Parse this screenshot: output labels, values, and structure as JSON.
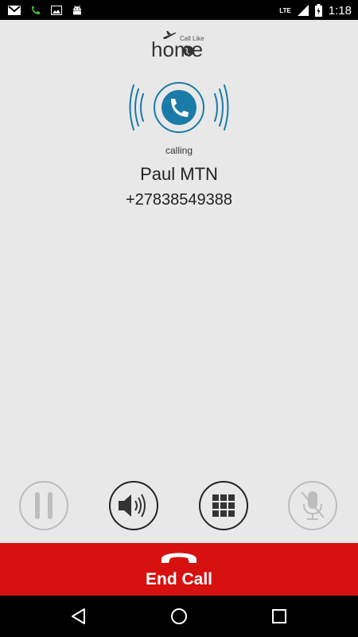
{
  "status_bar": {
    "time": "1:18",
    "network": "LTE",
    "left_icons": [
      "gmail-icon",
      "phone-call-icon",
      "image-icon",
      "android-icon"
    ]
  },
  "logo": {
    "brand": "home",
    "tagline": "Call Like"
  },
  "call": {
    "status": "calling",
    "contact_name": "Paul MTN",
    "contact_number": "+27838549388"
  },
  "controls": [
    {
      "name": "hold",
      "icon": "pause-icon",
      "enabled": false
    },
    {
      "name": "speaker",
      "icon": "speaker-icon",
      "enabled": true
    },
    {
      "name": "keypad",
      "icon": "keypad-icon",
      "enabled": true
    },
    {
      "name": "mute",
      "icon": "mic-off-icon",
      "enabled": false
    }
  ],
  "end_call": {
    "label": "End Call"
  },
  "colors": {
    "background": "#e8e8e8",
    "accent_blue": "#1a7aa8",
    "end_call_red": "#d71010"
  }
}
